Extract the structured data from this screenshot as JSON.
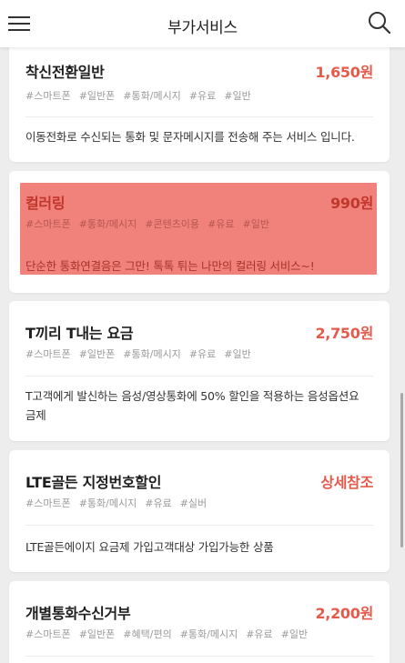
{
  "header": {
    "title": "부가서비스",
    "menu_icon": "hamburger-menu-icon",
    "search_icon": "search-icon"
  },
  "services": [
    {
      "name": "착신전환일반",
      "price": "1,650원",
      "tags": [
        "#스마트폰",
        "#일반폰",
        "#통화/메시지",
        "#유료",
        "#일반"
      ],
      "description": "이동전화로 수신되는 통화 및 문자메시지를 전송해 주는 서비스 입니다."
    },
    {
      "name": "컬러링",
      "price": "990원",
      "tags": [
        "#스마트폰",
        "#통화/메시지",
        "#콘텐츠이용",
        "#유료",
        "#일반"
      ],
      "description": "단순한 통화연결음은 그만! 톡톡 튀는 나만의 컬러링 서비스~!"
    },
    {
      "name": "T끼리 T내는 요금",
      "price": "2,750원",
      "tags": [
        "#스마트폰",
        "#일반폰",
        "#통화/메시지",
        "#유료",
        "#일반"
      ],
      "description": "T고객에게 발신하는 음성/영상통화에 50% 할인을 적용하는 음성옵션요금제"
    },
    {
      "name": "LTE골든 지정번호할인",
      "price": "상세참조",
      "tags": [
        "#스마트폰",
        "#통화/메시지",
        "#유료",
        "#실버"
      ],
      "description": "LTE골든에이지 요금제 가입고객대상 가입가능한 상품"
    },
    {
      "name": "개별통화수신거부",
      "price": "2,200원",
      "tags": [
        "#스마트폰",
        "#일반폰",
        "#혜택/편의",
        "#통화/메시지",
        "#유료",
        "#일반"
      ],
      "description": ""
    }
  ],
  "colors": {
    "price": "#e55b4b",
    "highlight": "#f1817b",
    "background": "#ededed"
  }
}
